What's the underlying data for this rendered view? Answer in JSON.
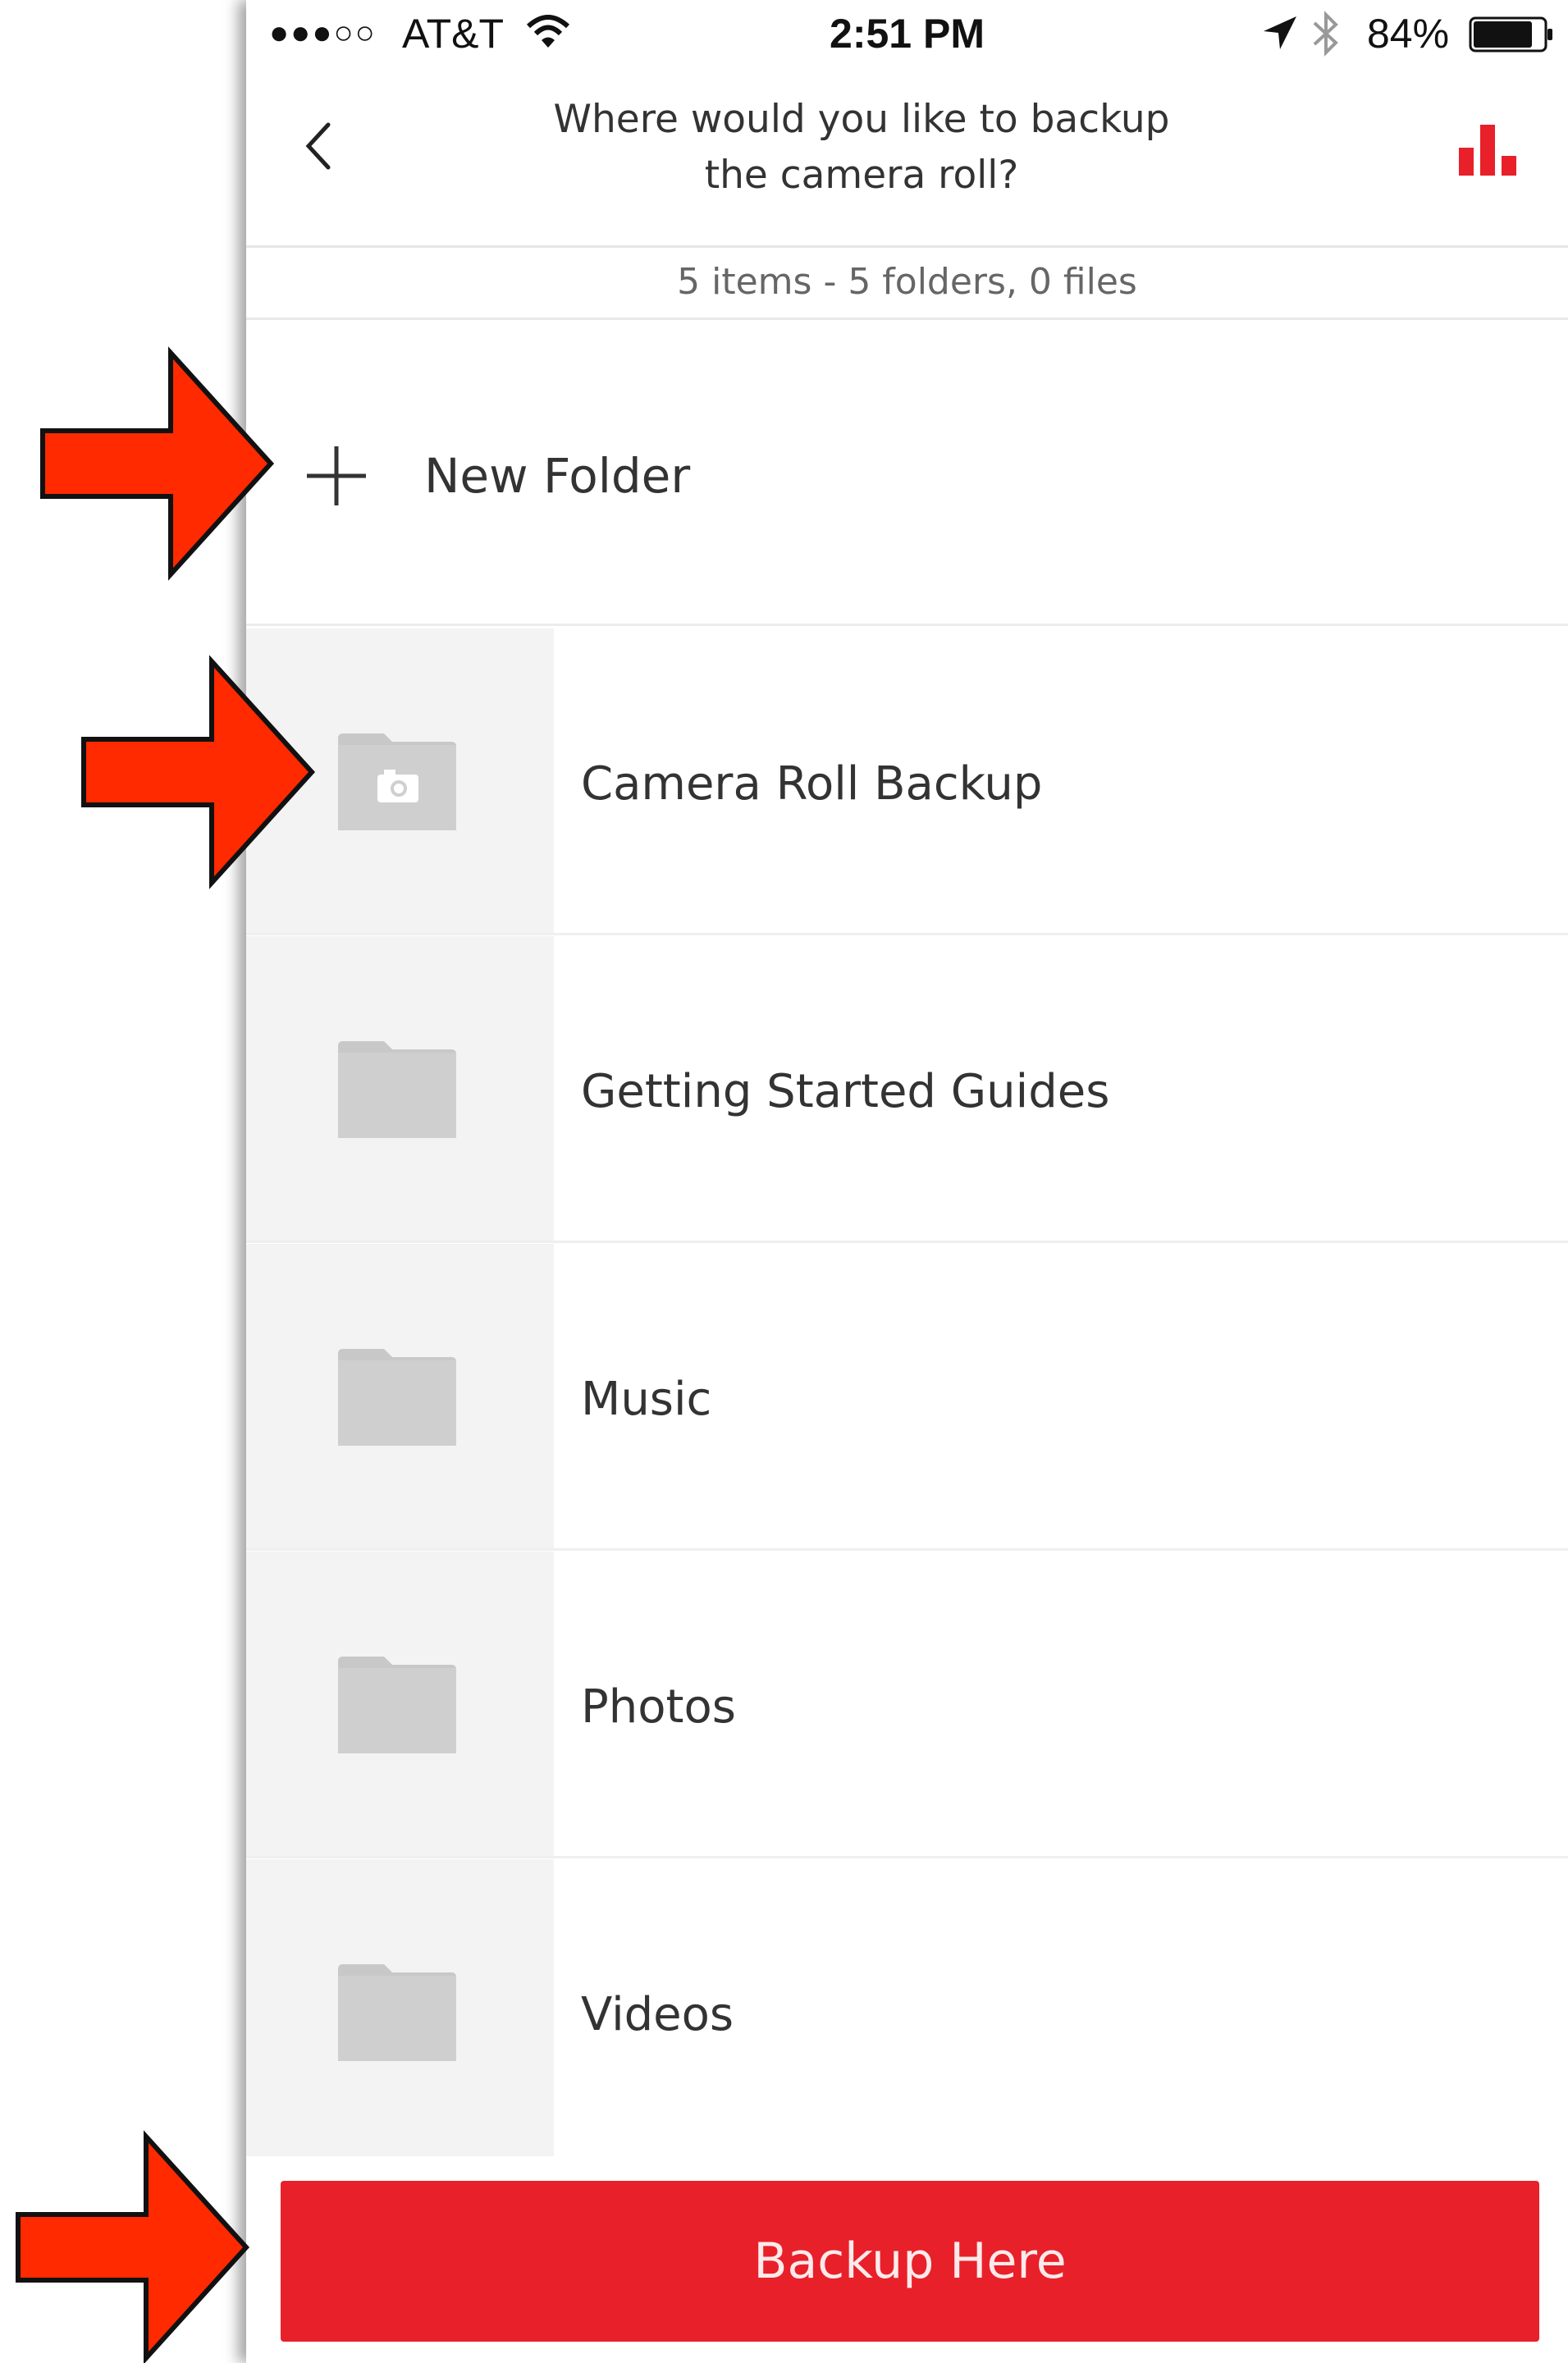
{
  "status_bar": {
    "signal": "●●●○○",
    "carrier": "AT&T",
    "time": "2:51 PM",
    "battery_percent": "84%",
    "battery_level": 0.84
  },
  "header": {
    "title": "Where would you like to backup the camera roll?"
  },
  "summary": "5 items - 5 folders, 0 files",
  "new_folder": {
    "label": "New Folder"
  },
  "folders": [
    {
      "name": "Camera Roll Backup",
      "icon": "camera-folder-icon"
    },
    {
      "name": "Getting Started Guides",
      "icon": "folder-icon"
    },
    {
      "name": "Music",
      "icon": "folder-icon"
    },
    {
      "name": "Photos",
      "icon": "folder-icon"
    },
    {
      "name": "Videos",
      "icon": "folder-icon"
    }
  ],
  "backup_button": {
    "label": "Backup Here"
  },
  "colors": {
    "accent": "#e8202a",
    "folder_gray": "#c8c8c8",
    "annotation_arrow": "#ff2a00"
  }
}
